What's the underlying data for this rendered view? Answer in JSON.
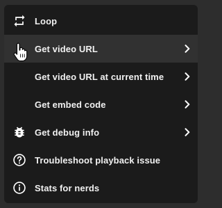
{
  "menu": {
    "items": [
      {
        "label": "Loop",
        "icon": "loop-icon",
        "submenu": false
      },
      {
        "label": "Get video URL",
        "icon": "",
        "submenu": true,
        "hovered": true
      },
      {
        "label": "Get video URL at current time",
        "icon": "",
        "submenu": true
      },
      {
        "label": "Get embed code",
        "icon": "",
        "submenu": true
      },
      {
        "label": "Get debug info",
        "icon": "bug-icon",
        "submenu": true
      },
      {
        "label": "Troubleshoot playback issue",
        "icon": "help-circle-icon",
        "submenu": false
      },
      {
        "label": "Stats for nerds",
        "icon": "info-circle-icon",
        "submenu": false
      }
    ]
  },
  "colors": {
    "menu_bg": "#1b1b1b",
    "hover_bg": "#313131",
    "text": "#f1f1f1",
    "page_bg": "#2d2d2d"
  },
  "cursor": "hand-pointer-icon"
}
